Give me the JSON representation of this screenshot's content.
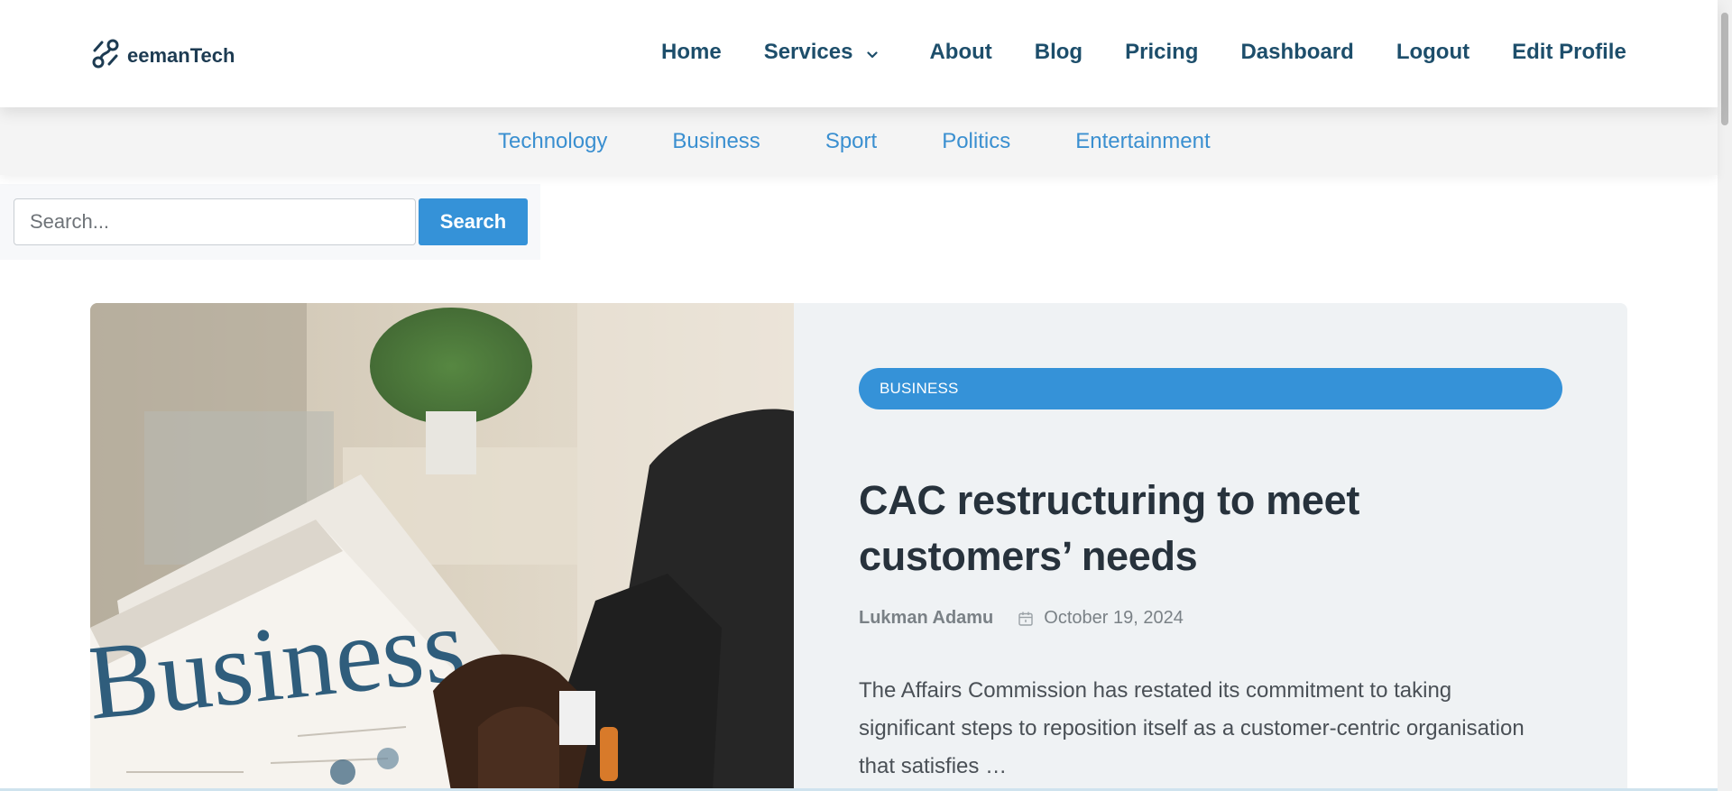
{
  "header": {
    "brand": "eemanTech",
    "nav": [
      {
        "label": "Home"
      },
      {
        "label": "Services"
      },
      {
        "label": "About"
      },
      {
        "label": "Blog"
      },
      {
        "label": "Pricing"
      },
      {
        "label": "Dashboard"
      },
      {
        "label": "Logout"
      },
      {
        "label": "Edit Profile"
      }
    ]
  },
  "categories": [
    "Technology",
    "Business",
    "Sport",
    "Politics",
    "Entertainment"
  ],
  "search": {
    "placeholder": "Search...",
    "value": "",
    "button": "Search"
  },
  "featured": {
    "category": "BUSINESS",
    "title": "CAC restructuring to meet customers’ needs",
    "author": "Lukman Adamu",
    "date": "October 19, 2024",
    "excerpt": "The Affairs Commission has restated its commitment to taking significant steps to reposition itself as a customer-centric organisation that satisfies …",
    "image_text": "Business"
  },
  "colors": {
    "accent": "#3592d8",
    "nav": "#1d4e6b",
    "category_link": "#3a8fd0",
    "card_bg": "#eff2f4"
  },
  "icons": {
    "logo": "link-icon",
    "services": "chevron-down-icon",
    "date": "calendar-icon"
  }
}
